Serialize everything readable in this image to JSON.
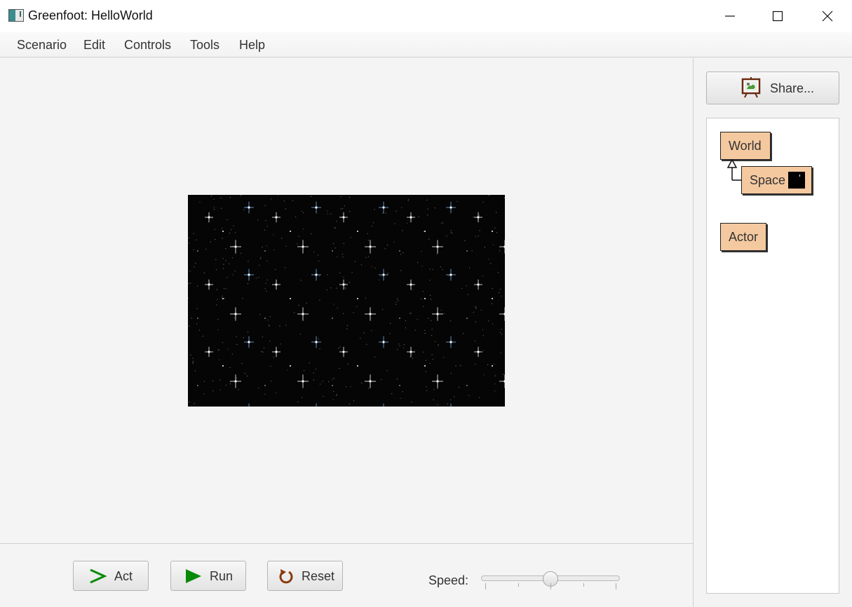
{
  "window": {
    "title": "Greenfoot: HelloWorld",
    "icons": {
      "app": "greenfoot-app-icon",
      "minimize": "minimize-icon",
      "maximize": "maximize-icon",
      "close": "close-icon"
    }
  },
  "menu": {
    "items": [
      "Scenario",
      "Edit",
      "Controls",
      "Tools",
      "Help"
    ]
  },
  "world": {
    "background": "starfield",
    "background_color": "#050505"
  },
  "sidebar": {
    "share_label": "Share...",
    "share_icon": "easel-picture-icon",
    "classes": [
      {
        "name": "World",
        "indent": 0
      },
      {
        "name": "Space",
        "indent": 1,
        "parent": "World",
        "has_thumbnail": true
      },
      {
        "name": "Actor",
        "indent": 0
      }
    ]
  },
  "controls": {
    "act_label": "Act",
    "run_label": "Run",
    "reset_label": "Reset",
    "speed_label": "Speed:",
    "speed_value": 0.5,
    "speed_ticks": 5,
    "colors": {
      "act": "#0a8a0a",
      "run": "#0a8a0a",
      "reset": "#8a3a0a"
    }
  }
}
